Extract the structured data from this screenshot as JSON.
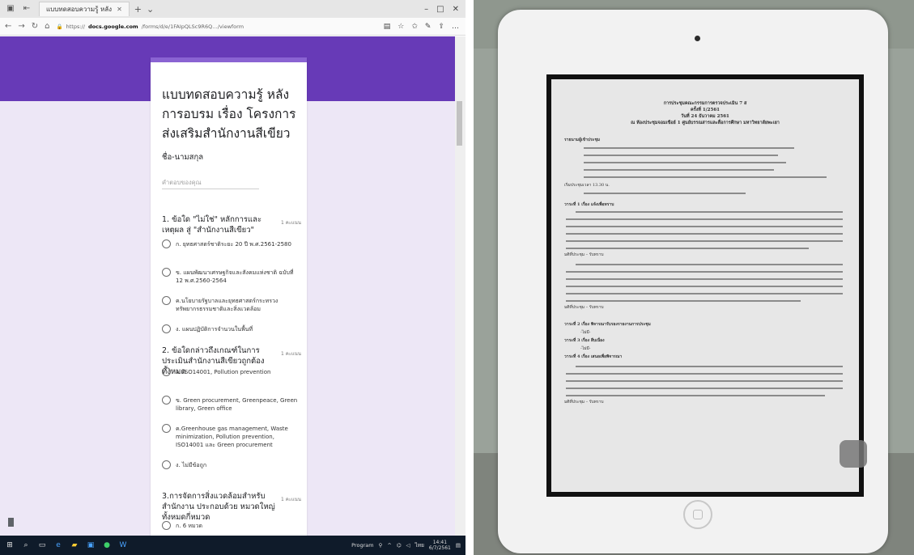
{
  "browser": {
    "tab_label": "แบบทดสอบความรู้ หลัง",
    "url_prefix": "https://",
    "url_domain": "docs.google.com",
    "url_rest": "/forms/d/e/1FAIpQLSc9R6Q…/viewform"
  },
  "form": {
    "title": "แบบทดสอบความรู้ หลัง การอบรม เรื่อง โครงการส่งเสริมสำนักงานสีเขียว",
    "name_label": "ชื่อ-นามสกุล",
    "name_placeholder": "คำตอบของคุณ",
    "questions": [
      {
        "title": "1. ข้อใด \"ไม่ใช่\" หลักการและเหตุผล สู่ \"สำนักงานสีเขียว\"",
        "points": "1 คะแนน",
        "options": [
          "ก. ยุทธศาสตร์ชาติระยะ 20 ปี พ.ศ.2561-2580",
          "ข. แผนพัฒนาเศรษฐกิจและสังคมแห่งชาติ ฉบับที่ 12 พ.ศ.2560-2564",
          "ค.นโยบายรัฐบาลและยุทธศาสตร์กระทรวงทรัพยากรธรรมชาติและสิ่งแวดล้อม",
          "ง. แผนปฏิบัติการจำนวนในพื้นที่"
        ]
      },
      {
        "title": "2. ข้อใดกล่าวถึงเกณฑ์ในการประเมินสำนักงานสีเขียวถูกต้องทั้งหมด",
        "points": "1 คะแนน",
        "options": [
          "ก. ISO14001, Pollution prevention",
          "ข. Green procurement, Greenpeace, Green library, Green office",
          "ค.Greenhouse gas management, Waste minimization, Pollution prevention, ISO14001 และ Green procurement",
          "ง. ไม่มีข้อถูก"
        ]
      },
      {
        "title": "3.การจัดการสิ่งแวดล้อมสำหรับสำนักงาน ประกอบด้วย หมวดใหญ่ทั้งหมดกี่หมวด",
        "points": "1 คะแนน",
        "options": [
          "ก. 6 หมวด"
        ]
      }
    ]
  },
  "taskbar": {
    "tray_label": "Program",
    "time": "14:41",
    "date": "6/7/2561"
  },
  "document": {
    "header_lines": [
      "การประชุมคณะกรรมการตรวจประเมิน 7 ส",
      "ครั้งที่ 1/2561",
      "วันที่ 24 ธันวาคม 2561",
      "ณ ห้องประชุมจอมเขือย์ 1 ศูนย์บรรณสารและสื่อการศึกษา มหาวิทยาลัยพะเยา"
    ],
    "lines": [
      "รายนามผู้เข้าประชุม",
      "เริ่มประชุมเวลา 13.30 น.",
      "วาระที่ 1 เรื่อง แจ้งเพื่อทราบ",
      "มติที่ประชุม – รับทราบ",
      "มติที่ประชุม – รับทราบ",
      "วาระที่ 2 เรื่อง พิจารณารับรองรายงานการประชุม",
      "-ไม่มี-",
      "วาระที่ 3 เรื่อง สืบเนื่อง",
      "-ไม่มี-",
      "วาระที่ 4 เรื่อง เสนอเพื่อพิจารณา",
      "มติที่ประชุม – รับทราบ"
    ]
  }
}
